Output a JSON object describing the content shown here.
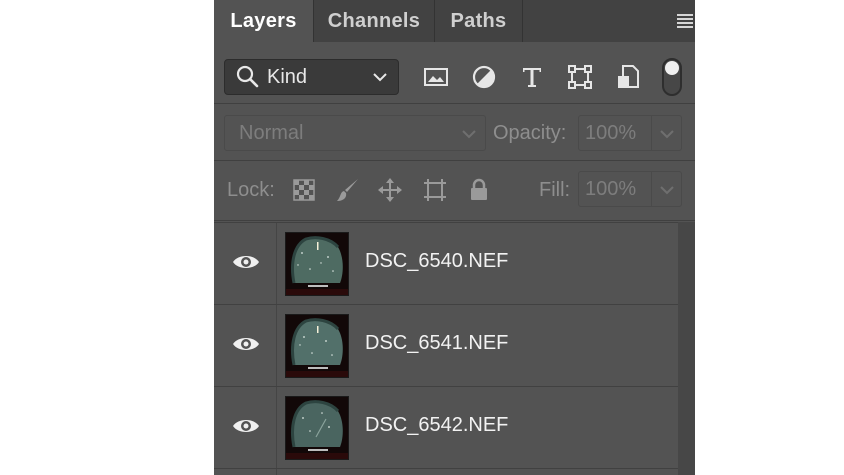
{
  "tabs": [
    {
      "label": "Layers",
      "active": true
    },
    {
      "label": "Channels",
      "active": false
    },
    {
      "label": "Paths",
      "active": false
    }
  ],
  "filter": {
    "kind_label": "Kind",
    "icons": [
      "image-filter-icon",
      "adjustment-filter-icon",
      "type-filter-icon",
      "shape-filter-icon",
      "smart-object-filter-icon"
    ],
    "filter_toggle_on": true
  },
  "blend": {
    "mode": "Normal",
    "opacity_label": "Opacity:",
    "opacity_value": "100%"
  },
  "lock": {
    "label": "Lock:",
    "icons": [
      "lock-transparent-pixels-icon",
      "lock-image-pixels-icon",
      "lock-position-icon",
      "lock-artboard-icon",
      "lock-all-icon"
    ],
    "fill_label": "Fill:",
    "fill_value": "100%"
  },
  "layers": [
    {
      "name": "DSC_6540.NEF",
      "visible": true
    },
    {
      "name": "DSC_6541.NEF",
      "visible": true
    },
    {
      "name": "DSC_6542.NEF",
      "visible": true
    }
  ],
  "colors": {
    "panel_bg": "#535353",
    "tab_bar_bg": "#424242",
    "text_active": "#ffffff",
    "text_dim": "#7d7d7d"
  }
}
